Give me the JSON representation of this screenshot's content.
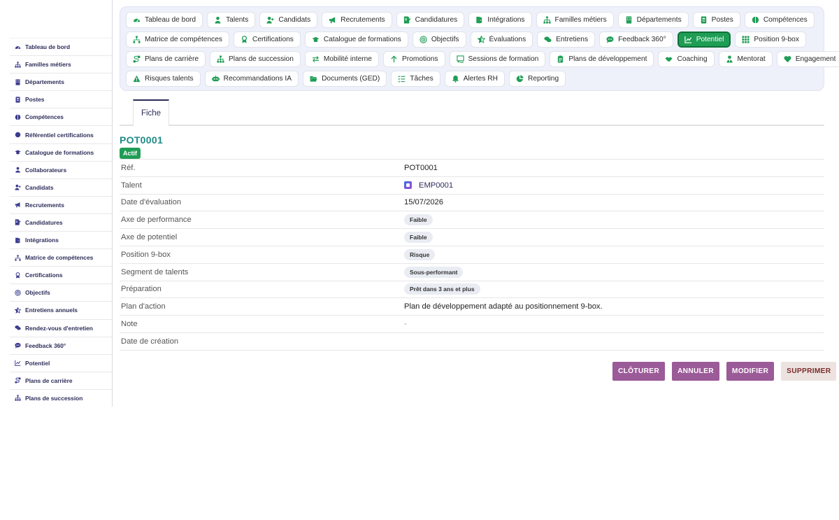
{
  "sidebar": {
    "items": [
      {
        "label": "Tableau de bord",
        "icon": "gauge-icon"
      },
      {
        "label": "Familles métiers",
        "icon": "sitemap-icon"
      },
      {
        "label": "Départements",
        "icon": "building-icon"
      },
      {
        "label": "Postes",
        "icon": "id-badge-icon"
      },
      {
        "label": "Compétences",
        "icon": "brain-icon"
      },
      {
        "label": "Référentiel certifications",
        "icon": "certificate-icon"
      },
      {
        "label": "Catalogue de formations",
        "icon": "graduation-cap-icon"
      },
      {
        "label": "Collaborateurs",
        "icon": "user-icon"
      },
      {
        "label": "Candidats",
        "icon": "user-plus-icon"
      },
      {
        "label": "Recrutements",
        "icon": "bullhorn-icon"
      },
      {
        "label": "Candidatures",
        "icon": "file-signature-icon"
      },
      {
        "label": "Intégrations",
        "icon": "door-open-icon"
      },
      {
        "label": "Matrice de compétences",
        "icon": "matrix-icon"
      },
      {
        "label": "Certifications",
        "icon": "award-icon"
      },
      {
        "label": "Objectifs",
        "icon": "target-icon"
      },
      {
        "label": "Entretiens annuels",
        "icon": "star-half-icon"
      },
      {
        "label": "Rendez-vous d'entretien",
        "icon": "comments-icon"
      },
      {
        "label": "Feedback 360°",
        "icon": "comment-dots-icon"
      },
      {
        "label": "Potentiel",
        "icon": "chart-line-icon"
      },
      {
        "label": "Plans de carrière",
        "icon": "route-icon"
      },
      {
        "label": "Plans de succession",
        "icon": "sitemap-icon"
      }
    ]
  },
  "topnav": {
    "rows": [
      [
        {
          "label": "Tableau de bord",
          "icon": "gauge-icon"
        },
        {
          "label": "Talents",
          "icon": "user-icon"
        },
        {
          "label": "Candidats",
          "icon": "user-plus-icon"
        },
        {
          "label": "Recrutements",
          "icon": "bullhorn-icon"
        },
        {
          "label": "Candidatures",
          "icon": "file-signature-icon"
        },
        {
          "label": "Intégrations",
          "icon": "door-open-icon"
        },
        {
          "label": "Familles métiers",
          "icon": "sitemap-icon"
        },
        {
          "label": "Départements",
          "icon": "building-icon"
        },
        {
          "label": "Postes",
          "icon": "id-badge-icon"
        },
        {
          "label": "Compétences",
          "icon": "brain-icon"
        }
      ],
      [
        {
          "label": "Matrice de compétences",
          "icon": "matrix-icon"
        },
        {
          "label": "Certifications",
          "icon": "award-icon"
        },
        {
          "label": "Catalogue de formations",
          "icon": "graduation-cap-icon"
        },
        {
          "label": "Objectifs",
          "icon": "target-icon"
        },
        {
          "label": "Évaluations",
          "icon": "star-half-icon"
        },
        {
          "label": "Entretiens",
          "icon": "comments-icon"
        },
        {
          "label": "Feedback 360°",
          "icon": "comment-dots-icon"
        },
        {
          "label": "Potentiel",
          "icon": "chart-line-icon",
          "active": true
        },
        {
          "label": "Position 9-box",
          "icon": "grid-icon"
        }
      ],
      [
        {
          "label": "Plans de carrière",
          "icon": "route-icon"
        },
        {
          "label": "Plans de succession",
          "icon": "sitemap-icon"
        },
        {
          "label": "Mobilité interne",
          "icon": "exchange-icon"
        },
        {
          "label": "Promotions",
          "icon": "arrow-up-icon"
        },
        {
          "label": "Sessions de formation",
          "icon": "chalkboard-icon"
        },
        {
          "label": "Plans de développement",
          "icon": "clipboard-icon"
        },
        {
          "label": "Coaching",
          "icon": "handshake-icon"
        },
        {
          "label": "Mentorat",
          "icon": "user-tie-icon"
        },
        {
          "label": "Engagement",
          "icon": "heart-icon"
        }
      ],
      [
        {
          "label": "Risques talents",
          "icon": "warning-icon"
        },
        {
          "label": "Recommandations IA",
          "icon": "robot-icon"
        },
        {
          "label": "Documents (GED)",
          "icon": "folder-open-icon"
        },
        {
          "label": "Tâches",
          "icon": "tasks-icon"
        },
        {
          "label": "Alertes RH",
          "icon": "bell-icon"
        },
        {
          "label": "Reporting",
          "icon": "chart-pie-icon"
        }
      ]
    ]
  },
  "tabs": {
    "active": "Fiche"
  },
  "record": {
    "title": "POT0001",
    "status": "Actif",
    "fields": [
      {
        "label": "Réf.",
        "value": "POT0001",
        "kind": "text"
      },
      {
        "label": "Talent",
        "value": "EMP0001",
        "kind": "link"
      },
      {
        "label": "Date d'évaluation",
        "value": "15/07/2026",
        "kind": "text"
      },
      {
        "label": "Axe de performance",
        "value": "Faible",
        "kind": "pill"
      },
      {
        "label": "Axe de potentiel",
        "value": "Faible",
        "kind": "pill"
      },
      {
        "label": "Position 9-box",
        "value": "Risque",
        "kind": "pill"
      },
      {
        "label": "Segment de talents",
        "value": "Sous-performant",
        "kind": "pill"
      },
      {
        "label": "Préparation",
        "value": "Prêt dans 3 ans et plus",
        "kind": "pill"
      },
      {
        "label": "Plan d'action",
        "value": "Plan de développement adapté au positionnement 9-box.",
        "kind": "text"
      },
      {
        "label": "Note",
        "value": "-",
        "kind": "muted"
      },
      {
        "label": "Date de création",
        "value": "",
        "kind": "text"
      }
    ]
  },
  "actions": [
    {
      "label": "CLÔTURER",
      "style": "purple"
    },
    {
      "label": "ANNULER",
      "style": "purple"
    },
    {
      "label": "MODIFIER",
      "style": "purple"
    },
    {
      "label": "SUPPRIMER",
      "style": "light"
    }
  ],
  "colors": {
    "accent": "#1f9d55",
    "title": "#1f8a86",
    "sidebar_text": "#2d2d5a",
    "action": "#9b5a98"
  }
}
